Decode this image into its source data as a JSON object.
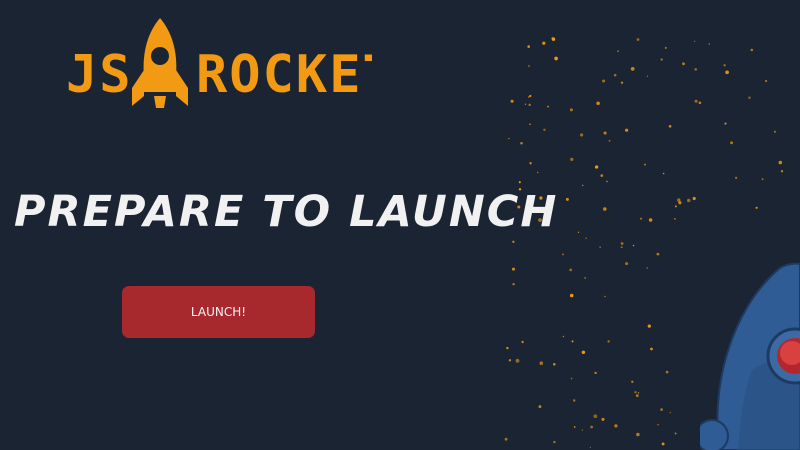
{
  "app": {
    "logo_text_left": "JS",
    "logo_text_right": "ROCKET",
    "headline": "PREPARE TO LAUNCH",
    "launch_button_label": "LAUNCH!"
  },
  "colors": {
    "background": "#1b2432",
    "logo_orange": "#f29a13",
    "headline_text": "#f1f1f1",
    "button_red": "#a8292d",
    "star": "#f29a13",
    "rocket_blue": "#2f5c95",
    "rocket_red_light": "#d94040"
  },
  "icons": {
    "logo_rocket": "rocket-icon",
    "stars": "star-icon",
    "spaceship": "spaceship-illustration"
  }
}
